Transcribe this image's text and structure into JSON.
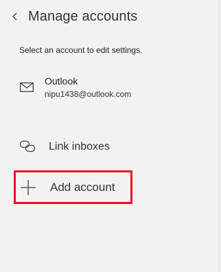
{
  "header": {
    "back_icon": "chevron-left-icon",
    "title": "Manage accounts"
  },
  "subtitle": "Select an account to edit settings.",
  "accounts": [
    {
      "icon": "mail-icon",
      "name": "Outlook",
      "email": "nipu1438@outlook.com"
    }
  ],
  "actions": {
    "link_inboxes": {
      "icon": "link-icon",
      "label": "Link inboxes"
    },
    "add_account": {
      "icon": "plus-icon",
      "label": "Add account",
      "highlight_color": "#e81123"
    }
  }
}
